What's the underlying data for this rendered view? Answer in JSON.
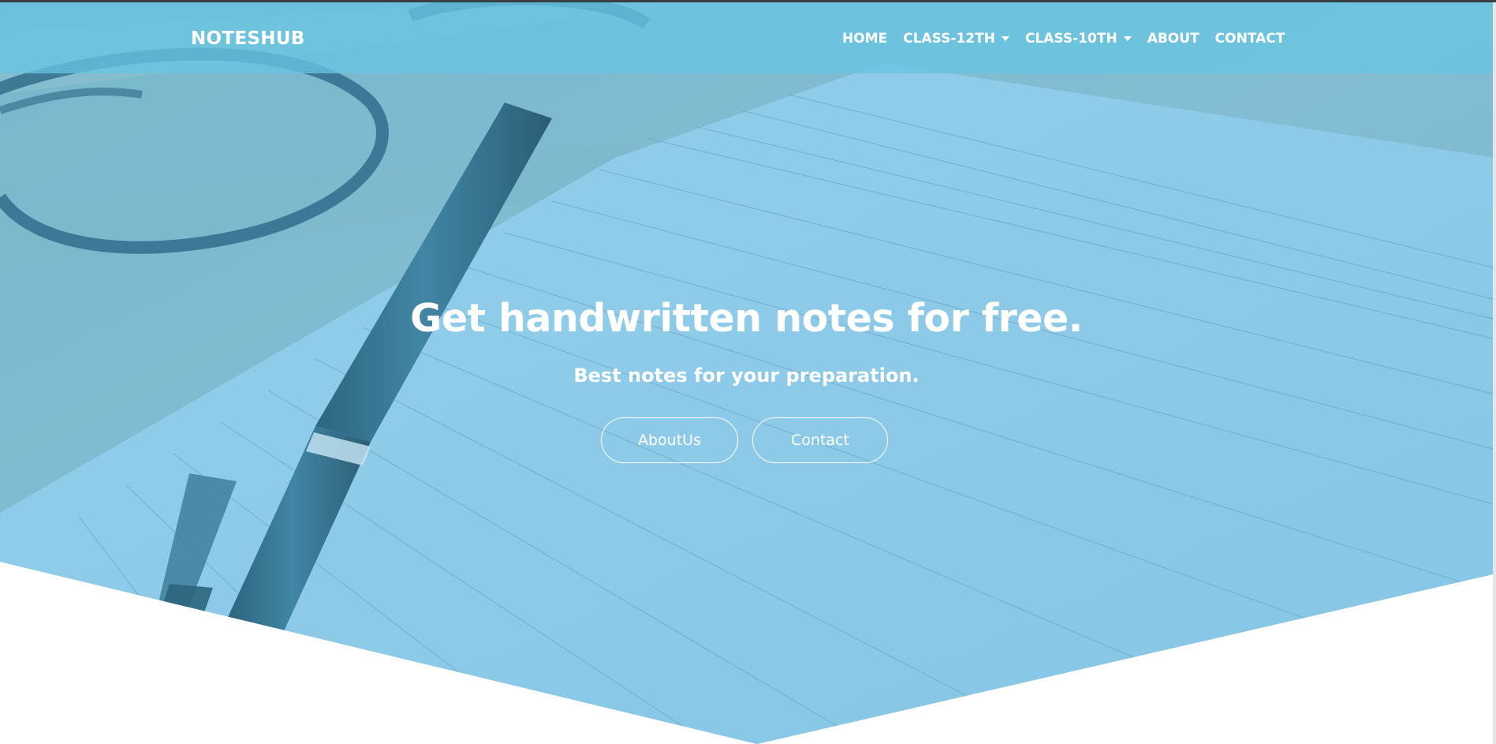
{
  "navbar": {
    "brand": "NOTESHUB",
    "items": [
      {
        "label": "HOME",
        "dropdown": false
      },
      {
        "label": "CLASS-12TH",
        "dropdown": true
      },
      {
        "label": "CLASS-10TH",
        "dropdown": true
      },
      {
        "label": "ABOUT",
        "dropdown": false
      },
      {
        "label": "CONTACT",
        "dropdown": false
      }
    ]
  },
  "hero": {
    "headline": "Get handwritten notes for free.",
    "subline": "Best notes for your preparation.",
    "buttons": {
      "about": "AboutUs",
      "contact": "Contact"
    },
    "overlay_color": "#6cc0e6"
  }
}
